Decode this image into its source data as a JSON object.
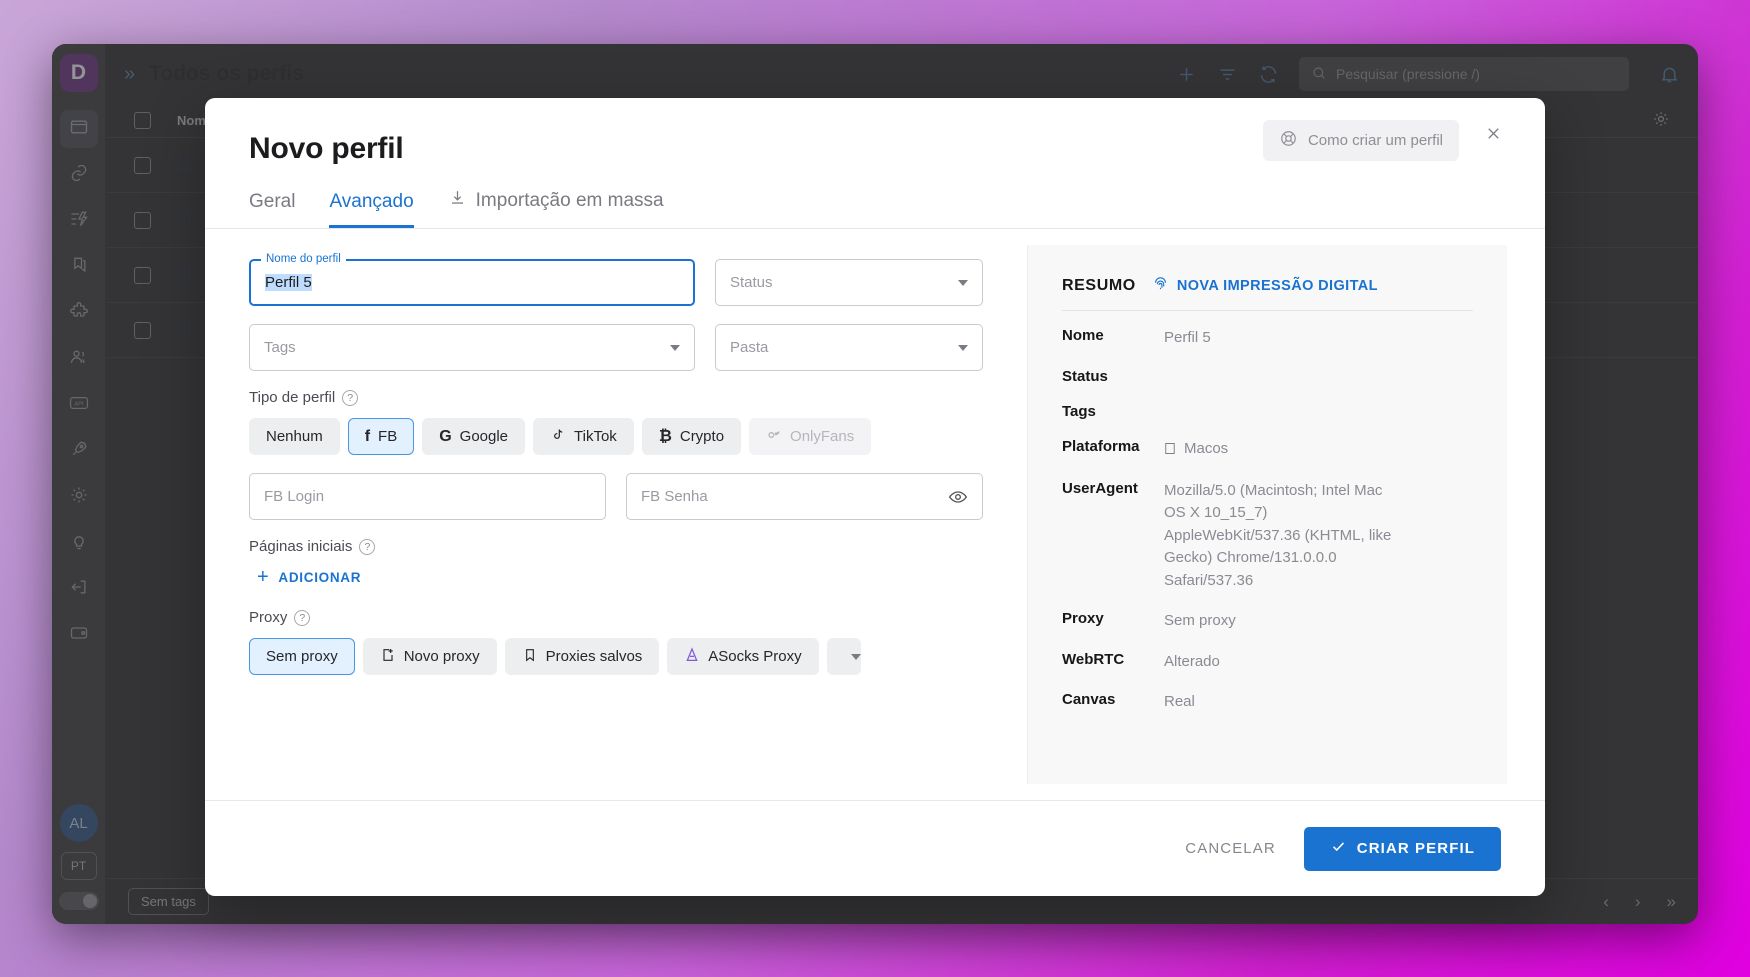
{
  "app": {
    "header": {
      "title": "Todos os perfis",
      "expand_icon": "double-chevron-right-icon",
      "add_icon": "plus-icon",
      "filter_icon": "filter-icon",
      "refresh_icon": "refresh-icon",
      "bell_icon": "bell-icon",
      "search_placeholder": "Pesquisar (pressione /)"
    },
    "sidebar": {
      "logo": "D",
      "items": [
        {
          "icon": "browser-window-icon",
          "active": true
        },
        {
          "icon": "link-icon",
          "active": false
        },
        {
          "icon": "automation-icon",
          "active": false
        },
        {
          "icon": "bookmarks-icon",
          "active": false
        },
        {
          "icon": "extension-puzzle-icon",
          "active": false
        },
        {
          "icon": "team-users-icon",
          "active": false
        },
        {
          "icon": "api-icon",
          "active": false
        },
        {
          "icon": "rocket-icon",
          "active": false
        },
        {
          "icon": "gear-icon",
          "active": false
        },
        {
          "icon": "lightbulb-icon",
          "active": false
        },
        {
          "icon": "logout-icon",
          "active": false
        },
        {
          "icon": "wallet-icon",
          "active": false
        }
      ],
      "avatar": "AL",
      "language": "PT"
    },
    "table": {
      "columns": [
        "",
        "Nome"
      ],
      "rows": [
        {
          "platform_icon": "apple-icon"
        },
        {
          "platform_icon": "apple-icon"
        },
        {
          "platform_icon": "apple-icon"
        },
        {
          "platform_icon": "apple-icon"
        }
      ]
    },
    "footer": {
      "tag_chip": "Sem tags",
      "pager": [
        "‹",
        "›",
        "»"
      ]
    }
  },
  "modal": {
    "title": "Novo perfil",
    "help_label": "Como criar um perfil",
    "help_icon": "lifebuoy-icon",
    "close_icon": "close-icon",
    "tabs": [
      {
        "label": "Geral",
        "active": false,
        "icon": null
      },
      {
        "label": "Avançado",
        "active": true,
        "icon": null
      },
      {
        "label": "Importação em massa",
        "active": false,
        "icon": "download-icon"
      }
    ],
    "form": {
      "profile_name": {
        "legend": "Nome do perfil",
        "value": "Perfil 5"
      },
      "status": {
        "placeholder": "Status",
        "value": ""
      },
      "tags": {
        "placeholder": "Tags",
        "value": ""
      },
      "folder": {
        "placeholder": "Pasta",
        "value": ""
      },
      "profile_type": {
        "label": "Tipo de perfil",
        "help_icon": "question-circle-icon",
        "options": [
          {
            "label": "Nenhum",
            "icon": null,
            "selected": false,
            "disabled": false
          },
          {
            "label": "FB",
            "icon": "facebook-icon",
            "selected": true,
            "disabled": false
          },
          {
            "label": "Google",
            "icon": "google-icon",
            "selected": false,
            "disabled": false
          },
          {
            "label": "TikTok",
            "icon": "tiktok-icon",
            "selected": false,
            "disabled": false
          },
          {
            "label": "Crypto",
            "icon": "bitcoin-icon",
            "selected": false,
            "disabled": false
          },
          {
            "label": "OnlyFans",
            "icon": "onlyfans-icon",
            "selected": false,
            "disabled": true
          }
        ]
      },
      "fb_login": {
        "placeholder": "FB Login",
        "value": ""
      },
      "fb_password": {
        "placeholder": "FB Senha",
        "value": "",
        "icon": "eye-icon"
      },
      "start_pages": {
        "label": "Páginas iniciais",
        "help_icon": "question-circle-icon",
        "add_label": "ADICIONAR",
        "add_icon": "plus-icon"
      },
      "proxy": {
        "label": "Proxy",
        "help_icon": "question-circle-icon",
        "options": [
          {
            "label": "Sem proxy",
            "icon": null,
            "selected": true
          },
          {
            "label": "Novo proxy",
            "icon": "new-proxy-icon",
            "selected": false
          },
          {
            "label": "Proxies salvos",
            "icon": "bookmark-icon",
            "selected": false
          },
          {
            "label": "ASocks Proxy",
            "icon": "asocks-icon",
            "selected": false
          }
        ],
        "dropdown_icon": "chevron-down-icon"
      }
    },
    "summary": {
      "title": "RESUMO",
      "new_fingerprint_label": "NOVA IMPRESSÃO DIGITAL",
      "new_fingerprint_icon": "fingerprint-icon",
      "rows": [
        {
          "key": "Nome",
          "value": "Perfil 5",
          "icon": null
        },
        {
          "key": "Status",
          "value": "",
          "icon": null
        },
        {
          "key": "Tags",
          "value": "",
          "icon": null
        },
        {
          "key": "Plataforma",
          "value": "Macos",
          "icon": "apple-icon"
        },
        {
          "key": "UserAgent",
          "value": "Mozilla/5.0 (Macintosh; Intel Mac OS X 10_15_7) AppleWebKit/537.36 (KHTML, like Gecko) Chrome/131.0.0.0 Safari/537.36",
          "icon": null
        },
        {
          "key": "Proxy",
          "value": "Sem proxy",
          "icon": null
        },
        {
          "key": "WebRTC",
          "value": "Alterado",
          "icon": null
        },
        {
          "key": "Canvas",
          "value": "Real",
          "icon": null
        }
      ]
    },
    "footer": {
      "cancel_label": "CANCELAR",
      "create_label": "CRIAR PERFIL",
      "create_icon": "check-icon"
    }
  },
  "colors": {
    "accent": "#1a73d0",
    "logo": "#6b2d84",
    "selected_text_bg": "#bfdcff"
  }
}
